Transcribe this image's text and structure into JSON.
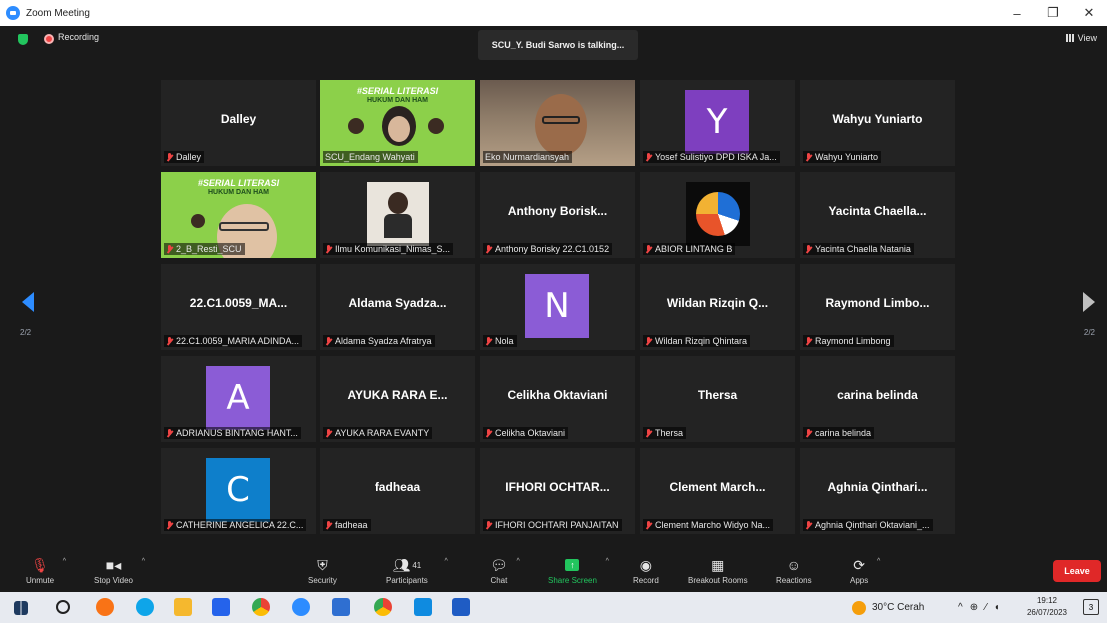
{
  "window": {
    "title": "Zoom Meeting",
    "minimize": "–",
    "maximize": "❐",
    "close": "✕"
  },
  "topbar": {
    "recording_label": "Recording",
    "talking": "SCU_Y. Budi Sarwo is talking...",
    "view_label": "View"
  },
  "pager": {
    "left_label": "2/2",
    "right_label": "2/2"
  },
  "tiles": [
    {
      "center": "Dalley",
      "label": "Dalley"
    },
    {
      "center": "",
      "label": "SCU_Endang Wahyati",
      "banner": "#SERIAL LITERASI",
      "banner_sub": "HUKUM DAN HAM"
    },
    {
      "center": "",
      "label": "Eko Nurmardiansyah"
    },
    {
      "center": "",
      "label": "Yosef Sulistiyo DPD ISKA Ja...",
      "avatar": "Y",
      "avatar_color": "#7e3fbf"
    },
    {
      "center": "Wahyu Yuniarto",
      "label": "Wahyu Yuniarto"
    },
    {
      "center": "",
      "label": "2_B_Resti_SCU",
      "banner": "#SERIAL LITERASI",
      "banner_sub": "HUKUM DAN HAM"
    },
    {
      "center": "",
      "label": "Ilmu Komunikasi_Nimas_S..."
    },
    {
      "center": "Anthony Borisk...",
      "label": "Anthony Borisky 22.C1.0152"
    },
    {
      "center": "",
      "label": "ABIOR LINTANG B"
    },
    {
      "center": "Yacinta Chaella...",
      "label": "Yacinta Chaella Natania"
    },
    {
      "center": "22.C1.0059_MA...",
      "label": "22.C1.0059_MARIA ADINDA..."
    },
    {
      "center": "Aldama Syadza...",
      "label": "Aldama Syadza Afratrya"
    },
    {
      "center": "",
      "label": "Nola",
      "avatar": "N",
      "avatar_color": "#8b5cd6"
    },
    {
      "center": "Wildan Rizqin Q...",
      "label": "Wildan Rizqin Qhintara"
    },
    {
      "center": "Raymond Limbo...",
      "label": "Raymond Limbong"
    },
    {
      "center": "",
      "label": "ADRIANUS BINTANG HANT...",
      "avatar": "A",
      "avatar_color": "#8b5cd6"
    },
    {
      "center": "AYUKA RARA E...",
      "label": "AYUKA RARA EVANTY"
    },
    {
      "center": "Celikha Oktaviani",
      "label": "Celikha Oktaviani"
    },
    {
      "center": "Thersa",
      "label": "Thersa"
    },
    {
      "center": "carina belinda",
      "label": "carina belinda"
    },
    {
      "center": "",
      "label": "CATHERINE ANGELICA 22.C...",
      "avatar": "C",
      "avatar_color": "#0e7fcb"
    },
    {
      "center": "fadheaa",
      "label": "fadheaa"
    },
    {
      "center": "IFHORI OCHTAR...",
      "label": "IFHORI OCHTARI PANJAITAN"
    },
    {
      "center": "Clement March...",
      "label": "Clement Marcho Widyo Na..."
    },
    {
      "center": "Aghnia Qinthari...",
      "label": "Aghnia Qinthari Oktaviani_..."
    }
  ],
  "toolbar": {
    "unmute": "Unmute",
    "stop_video": "Stop Video",
    "security": "Security",
    "participants": "Participants",
    "participants_count": "41",
    "chat": "Chat",
    "share_screen": "Share Screen",
    "record": "Record",
    "breakout_rooms": "Breakout Rooms",
    "reactions": "Reactions",
    "apps": "Apps",
    "leave": "Leave"
  },
  "taskbar": {
    "weather": "30°C  Cerah",
    "time": "19:12",
    "date": "26/07/2023",
    "notif_count": "3"
  }
}
